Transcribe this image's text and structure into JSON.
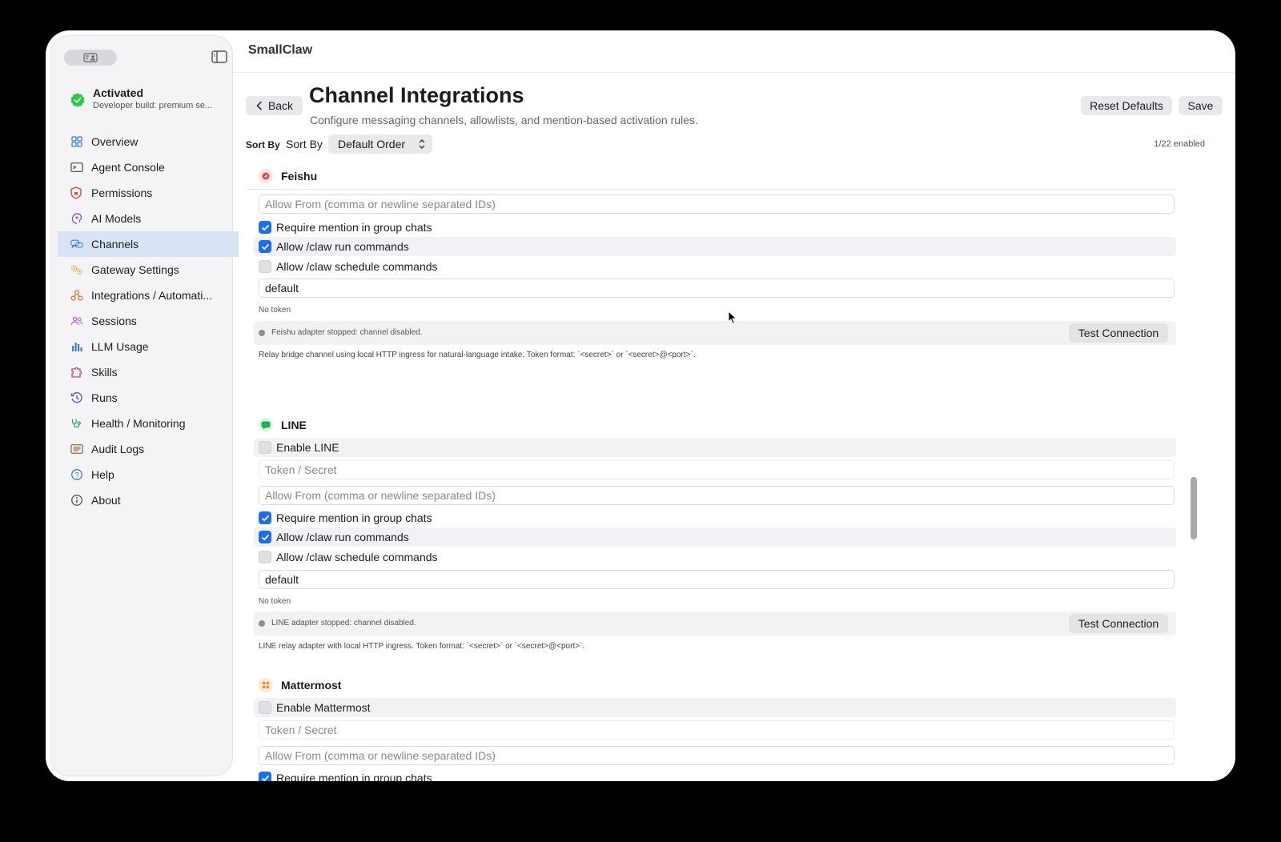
{
  "app": {
    "title": "SmallClaw"
  },
  "activation": {
    "title": "Activated",
    "subtitle": "Developer build: premium se..."
  },
  "sidebar": {
    "items": [
      {
        "label": "Overview",
        "icon": "grid-icon"
      },
      {
        "label": "Agent Console",
        "icon": "terminal-icon"
      },
      {
        "label": "Permissions",
        "icon": "shield-icon"
      },
      {
        "label": "AI Models",
        "icon": "brain-icon"
      },
      {
        "label": "Channels",
        "icon": "chat-bubbles-icon",
        "active": true
      },
      {
        "label": "Gateway Settings",
        "icon": "gears-icon"
      },
      {
        "label": "Integrations / Automati...",
        "icon": "integrations-icon"
      },
      {
        "label": "Sessions",
        "icon": "people-icon"
      },
      {
        "label": "LLM Usage",
        "icon": "bar-chart-icon"
      },
      {
        "label": "Skills",
        "icon": "puzzle-icon"
      },
      {
        "label": "Runs",
        "icon": "history-icon"
      },
      {
        "label": "Health / Monitoring",
        "icon": "stethoscope-icon"
      },
      {
        "label": "Audit Logs",
        "icon": "list-icon"
      },
      {
        "label": "Help",
        "icon": "question-icon"
      },
      {
        "label": "About",
        "icon": "info-icon"
      }
    ]
  },
  "header": {
    "back": "Back",
    "title": "Channel Integrations",
    "subtitle": "Configure messaging channels, allowlists, and mention-based activation rules.",
    "reset": "Reset Defaults",
    "save": "Save"
  },
  "sort": {
    "label_bold": "Sort By",
    "label": "Sort By",
    "value": "Default Order",
    "enabled_count": "1/22 enabled"
  },
  "channels": {
    "feishu": {
      "name": "Feishu",
      "allow_placeholder": "Allow From (comma or newline separated IDs)",
      "require_mention": "Require mention in group chats",
      "allow_run": "Allow /claw run commands",
      "allow_schedule": "Allow /claw schedule commands",
      "profile": "default",
      "token_status": "No token",
      "status": "Feishu adapter stopped: channel disabled.",
      "test": "Test Connection",
      "description": "Relay bridge channel using local HTTP ingress for natural-language intake. Token format: `<secret>` or `<secret>@<port>`."
    },
    "line": {
      "name": "LINE",
      "enable": "Enable LINE",
      "token_placeholder": "Token / Secret",
      "allow_placeholder": "Allow From (comma or newline separated IDs)",
      "require_mention": "Require mention in group chats",
      "allow_run": "Allow /claw run commands",
      "allow_schedule": "Allow /claw schedule commands",
      "profile": "default",
      "token_status": "No token",
      "status": "LINE adapter stopped: channel disabled.",
      "test": "Test Connection",
      "description": "LINE relay adapter with local HTTP ingress. Token format: `<secret>` or `<secret>@<port>`."
    },
    "mattermost": {
      "name": "Mattermost",
      "enable": "Enable Mattermost",
      "token_placeholder": "Token / Secret",
      "allow_placeholder": "Allow From (comma or newline separated IDs)",
      "require_mention": "Require mention in group chats"
    }
  },
  "colors": {
    "accent": "#1a6ef5",
    "active_nav": "#d8e4f6",
    "activated_green": "#28c840"
  }
}
